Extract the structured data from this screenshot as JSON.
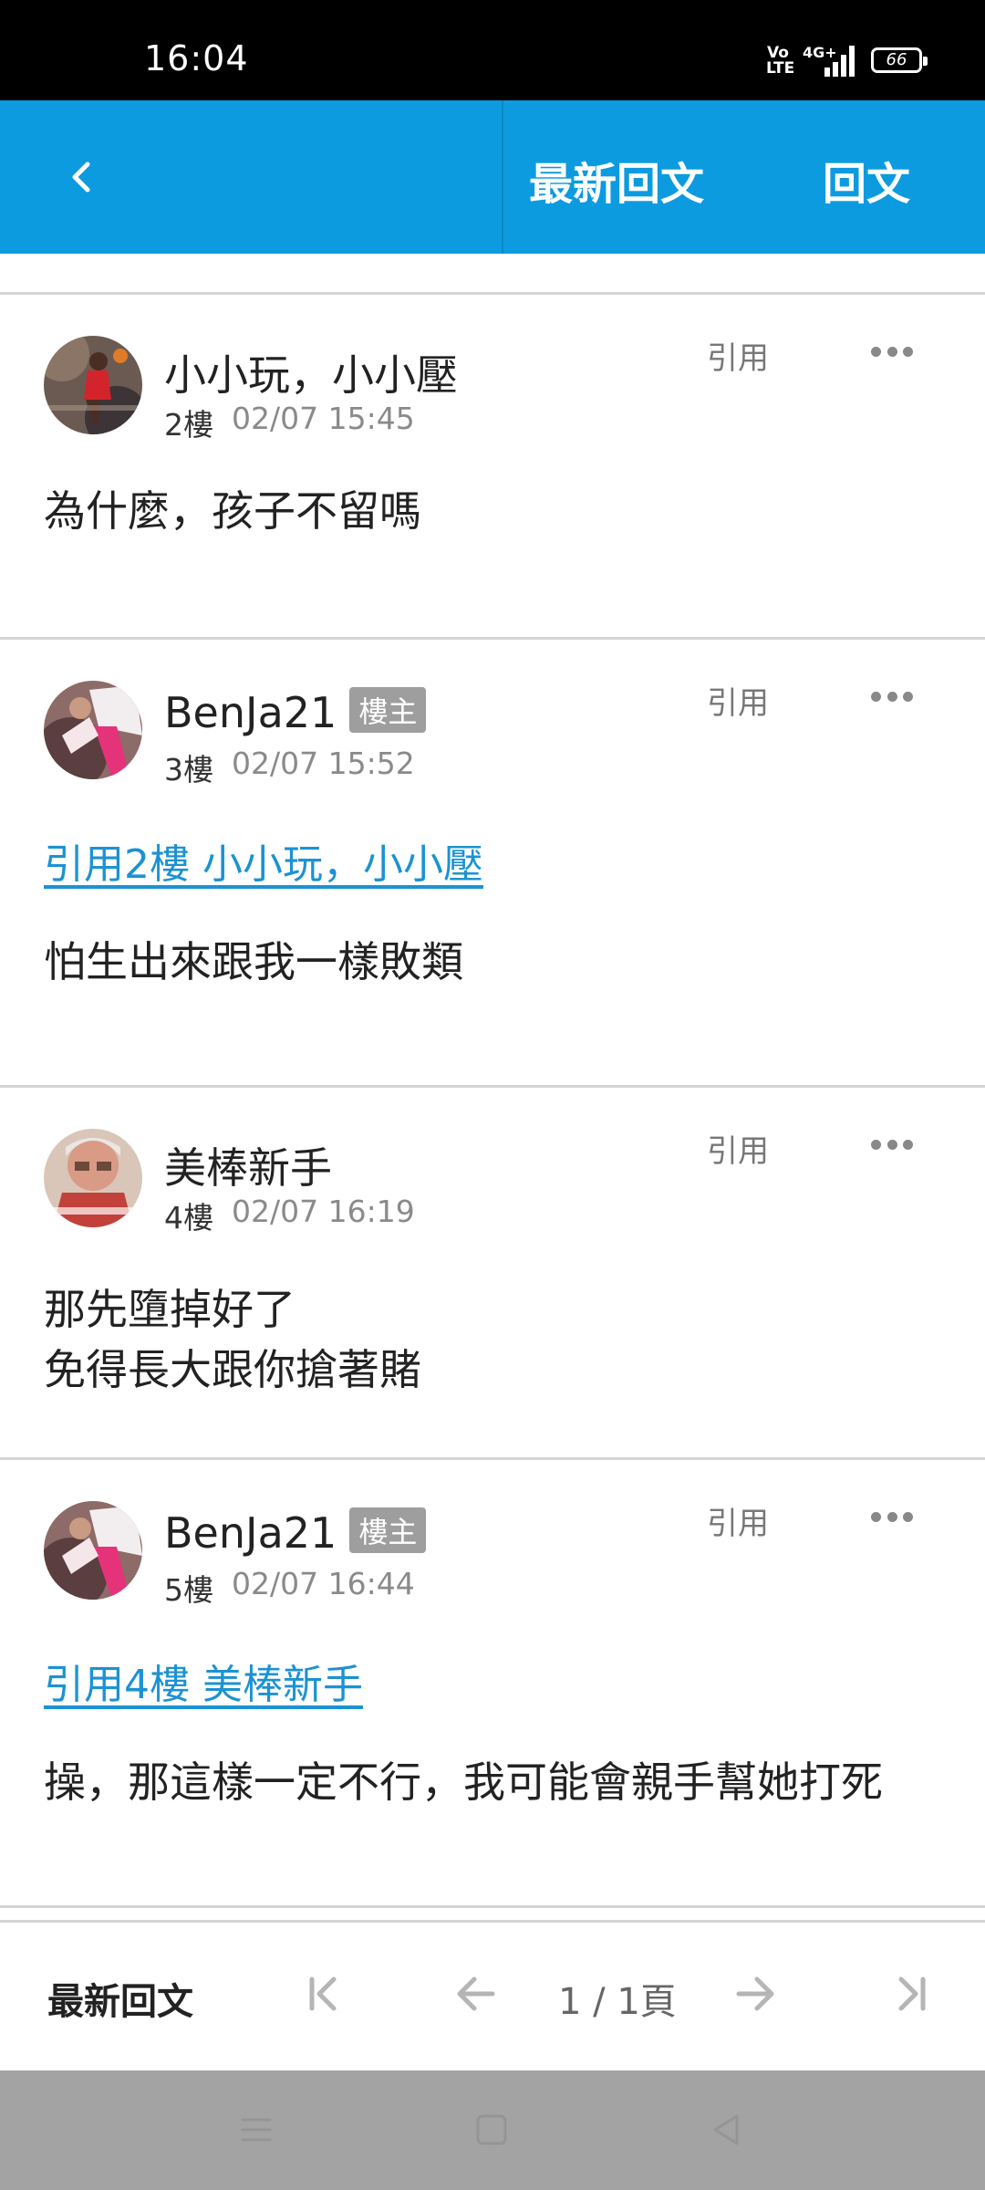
{
  "status_bar": {
    "time": "16:04",
    "volte": "Vo\nLTE",
    "network": "4G+",
    "battery": "66"
  },
  "app_bar": {
    "latest_label": "最新回文",
    "reply_label": "回文"
  },
  "posts": [
    {
      "author": "小小玩，小小壓",
      "badge": "",
      "floor": "2樓",
      "time": "02/07 15:45",
      "quote_label": "引用",
      "quote_ref": "",
      "content": [
        "為什麼，孩子不留嗎"
      ]
    },
    {
      "author": "BenJa21",
      "badge": "樓主",
      "floor": "3樓",
      "time": "02/07 15:52",
      "quote_label": "引用",
      "quote_ref": "引用2樓 小小玩，小小壓",
      "content": [
        "怕生出來跟我一樣敗類"
      ]
    },
    {
      "author": "美棒新手",
      "badge": "",
      "floor": "4樓",
      "time": "02/07 16:19",
      "quote_label": "引用",
      "quote_ref": "",
      "content": [
        "那先墮掉好了",
        "免得長大跟你搶著賭"
      ]
    },
    {
      "author": "BenJa21",
      "badge": "樓主",
      "floor": "5樓",
      "time": "02/07 16:44",
      "quote_label": "引用",
      "quote_ref": "引用4樓 美棒新手",
      "content": [
        "操，那這樣一定不行，我可能會親手幫她打死"
      ]
    }
  ],
  "pagination": {
    "latest_label": "最新回文",
    "page_text": "1 / 1頁"
  },
  "colors": {
    "accent": "#0d9be0",
    "link": "#1c92d2",
    "badge": "#9e9e9e"
  },
  "icons": [
    "back-icon",
    "more-icon",
    "first-page-icon",
    "prev-page-icon",
    "next-page-icon",
    "last-page-icon",
    "menu-icon",
    "home-icon",
    "back-nav-icon"
  ]
}
